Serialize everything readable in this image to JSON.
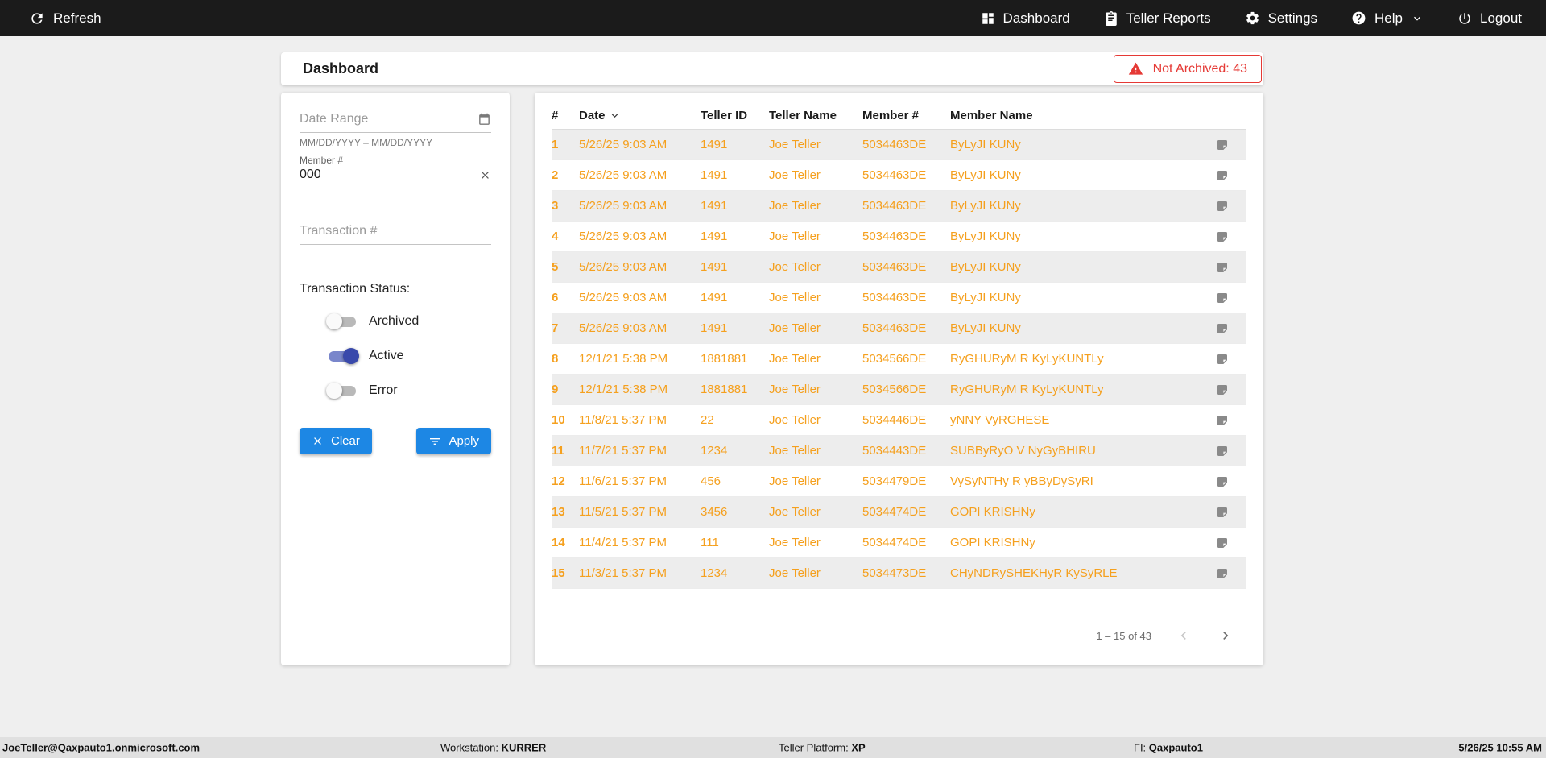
{
  "colors": {
    "topbar_bg": "#1b1b1b",
    "accent_blue": "#1d87e4",
    "toggle_on_blue": "#3949ab",
    "row_orange": "#f5a01e",
    "alert_red": "#e53935",
    "page_bg": "#efefef"
  },
  "topbar": {
    "refresh_label": "Refresh",
    "nav": [
      {
        "label": "Dashboard"
      },
      {
        "label": "Teller Reports"
      },
      {
        "label": "Settings"
      },
      {
        "label": "Help"
      },
      {
        "label": "Logout"
      }
    ]
  },
  "header": {
    "title": "Dashboard",
    "not_archived_label": "Not Archived: 43"
  },
  "filters": {
    "date_range_placeholder": "Date Range",
    "date_range_helper": "MM/DD/YYYY – MM/DD/YYYY",
    "member_label": "Member #",
    "member_value": "000",
    "transaction_placeholder": "Transaction #",
    "status_label": "Transaction Status:",
    "toggles": [
      {
        "label": "Archived",
        "on": false
      },
      {
        "label": "Active",
        "on": true
      },
      {
        "label": "Error",
        "on": false
      }
    ],
    "clear_label": "Clear",
    "apply_label": "Apply"
  },
  "table": {
    "columns": [
      "#",
      "Date",
      "Teller ID",
      "Teller Name",
      "Member #",
      "Member Name"
    ],
    "rows": [
      [
        "1",
        "5/26/25 9:03 AM",
        "1491",
        "Joe Teller",
        "5034463DE",
        "ByLyJI KUNy"
      ],
      [
        "2",
        "5/26/25 9:03 AM",
        "1491",
        "Joe Teller",
        "5034463DE",
        "ByLyJI KUNy"
      ],
      [
        "3",
        "5/26/25 9:03 AM",
        "1491",
        "Joe Teller",
        "5034463DE",
        "ByLyJI KUNy"
      ],
      [
        "4",
        "5/26/25 9:03 AM",
        "1491",
        "Joe Teller",
        "5034463DE",
        "ByLyJI KUNy"
      ],
      [
        "5",
        "5/26/25 9:03 AM",
        "1491",
        "Joe Teller",
        "5034463DE",
        "ByLyJI KUNy"
      ],
      [
        "6",
        "5/26/25 9:03 AM",
        "1491",
        "Joe Teller",
        "5034463DE",
        "ByLyJI KUNy"
      ],
      [
        "7",
        "5/26/25 9:03 AM",
        "1491",
        "Joe Teller",
        "5034463DE",
        "ByLyJI KUNy"
      ],
      [
        "8",
        "12/1/21 5:38 PM",
        "1881881",
        "Joe Teller",
        "5034566DE",
        "RyGHURyM R KyLyKUNTLy"
      ],
      [
        "9",
        "12/1/21 5:38 PM",
        "1881881",
        "Joe Teller",
        "5034566DE",
        "RyGHURyM R KyLyKUNTLy"
      ],
      [
        "10",
        "11/8/21 5:37 PM",
        "22",
        "Joe Teller",
        "5034446DE",
        "yNNY VyRGHESE"
      ],
      [
        "11",
        "11/7/21 5:37 PM",
        "1234",
        "Joe Teller",
        "5034443DE",
        "SUBByRyO V NyGyBHIRU"
      ],
      [
        "12",
        "11/6/21 5:37 PM",
        "456",
        "Joe Teller",
        "5034479DE",
        "VySyNTHy R yBByDySyRI"
      ],
      [
        "13",
        "11/5/21 5:37 PM",
        "3456",
        "Joe Teller",
        "5034474DE",
        "GOPI KRISHNy"
      ],
      [
        "14",
        "11/4/21 5:37 PM",
        "111",
        "Joe Teller",
        "5034474DE",
        "GOPI KRISHNy"
      ],
      [
        "15",
        "11/3/21 5:37 PM",
        "1234",
        "Joe Teller",
        "5034473DE",
        "CHyNDRySHEKHyR KySyRLE"
      ]
    ],
    "pagination": "1 – 15 of 43"
  },
  "statusbar": {
    "user": "JoeTeller@Qaxpauto1.onmicrosoft.com",
    "workstation_label": "Workstation: ",
    "workstation_value": "KURRER",
    "platform_label": "Teller Platform: ",
    "platform_value": "XP",
    "fi_label": "FI: ",
    "fi_value": "Qaxpauto1",
    "datetime": "5/26/25 10:55 AM"
  }
}
